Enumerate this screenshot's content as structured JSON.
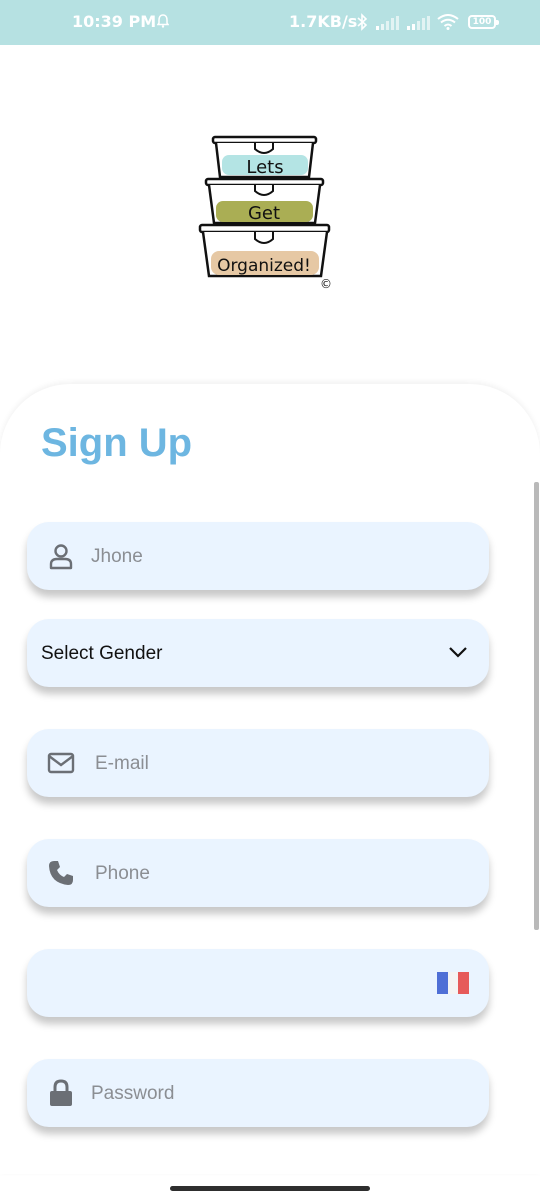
{
  "status_bar": {
    "time": "10:39 PM",
    "network_speed": "1.7KB/s",
    "battery": "100"
  },
  "logo": {
    "line1": "Lets",
    "line2": "Get",
    "line3": "Organized!",
    "copyright": "©"
  },
  "form": {
    "title": "Sign Up",
    "name_placeholder": "Jhone",
    "gender_selected": "Select Gender",
    "email_placeholder": "E-mail",
    "phone_placeholder": "Phone",
    "password_placeholder": "Password"
  },
  "colors": {
    "status_bar_bg": "#b6e1e2",
    "title": "#6db6e1",
    "field_bg": "#eaf4ff",
    "icon": "#6b6f75"
  }
}
